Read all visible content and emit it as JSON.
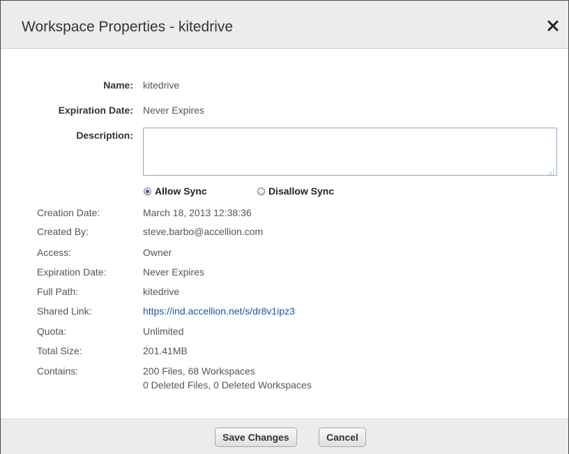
{
  "dialog": {
    "title": "Workspace Properties - kitedrive",
    "close_icon": "close-icon"
  },
  "top_fields": {
    "name_label": "Name:",
    "name_value": "kitedrive",
    "expiration_label": "Expiration Date:",
    "expiration_value": "Never Expires",
    "description_label": "Description:",
    "description_value": ""
  },
  "sync": {
    "allow_label": "Allow Sync",
    "disallow_label": "Disallow Sync",
    "selected": "Allow Sync"
  },
  "details": {
    "creation_date_label": "Creation Date:",
    "creation_date_value": "March 18, 2013 12:38:36",
    "created_by_label": "Created By:",
    "created_by_value": "steve.barbo@accellion.com",
    "access_label": "Access:",
    "access_value": "Owner",
    "expiration_label": "Expiration Date:",
    "expiration_value": "Never Expires",
    "full_path_label": "Full Path:",
    "full_path_value": "kitedrive",
    "shared_link_label": "Shared Link:",
    "shared_link_value": "https://ind.accellion.net/s/dr8v1ipz3",
    "quota_label": "Quota:",
    "quota_value": "Unlimited",
    "total_size_label": "Total Size:",
    "total_size_value": "201.41MB",
    "contains_label": "Contains:",
    "contains_line1": "200 Files, 68 Workspaces",
    "contains_line2": "0 Deleted Files, 0 Deleted Workspaces"
  },
  "footer": {
    "save_label": "Save Changes",
    "cancel_label": "Cancel"
  }
}
